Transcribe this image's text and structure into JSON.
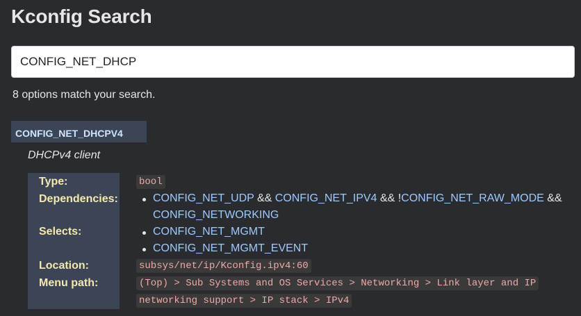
{
  "header": {
    "title": "Kconfig Search"
  },
  "search": {
    "value": "CONFIG_NET_DHCP"
  },
  "results": {
    "count_text": "8 options match your search."
  },
  "option": {
    "name": "CONFIG_NET_DHCPV4",
    "prompt": "DHCPv4 client",
    "labels": {
      "type": "Type:",
      "dependencies": "Dependencies:",
      "selects": "Selects:",
      "location": "Location:",
      "menu_path": "Menu path:"
    },
    "type": "bool",
    "dependencies": {
      "dep1": "CONFIG_NET_UDP",
      "op1": " && ",
      "dep2": "CONFIG_NET_IPV4",
      "op2": " && !",
      "dep3": "CONFIG_NET_RAW_MODE",
      "op3": " &&",
      "dep4": "CONFIG_NETWORKING"
    },
    "selects": [
      "CONFIG_NET_MGMT",
      "CONFIG_NET_MGMT_EVENT"
    ],
    "location": "subsys/net/ip/Kconfig.ipv4:60",
    "menu_path": {
      "line1": "(Top) > Sub Systems and OS Services > Networking > Link layer and IP",
      "line2": "networking support > IP stack > IPv4"
    }
  }
}
